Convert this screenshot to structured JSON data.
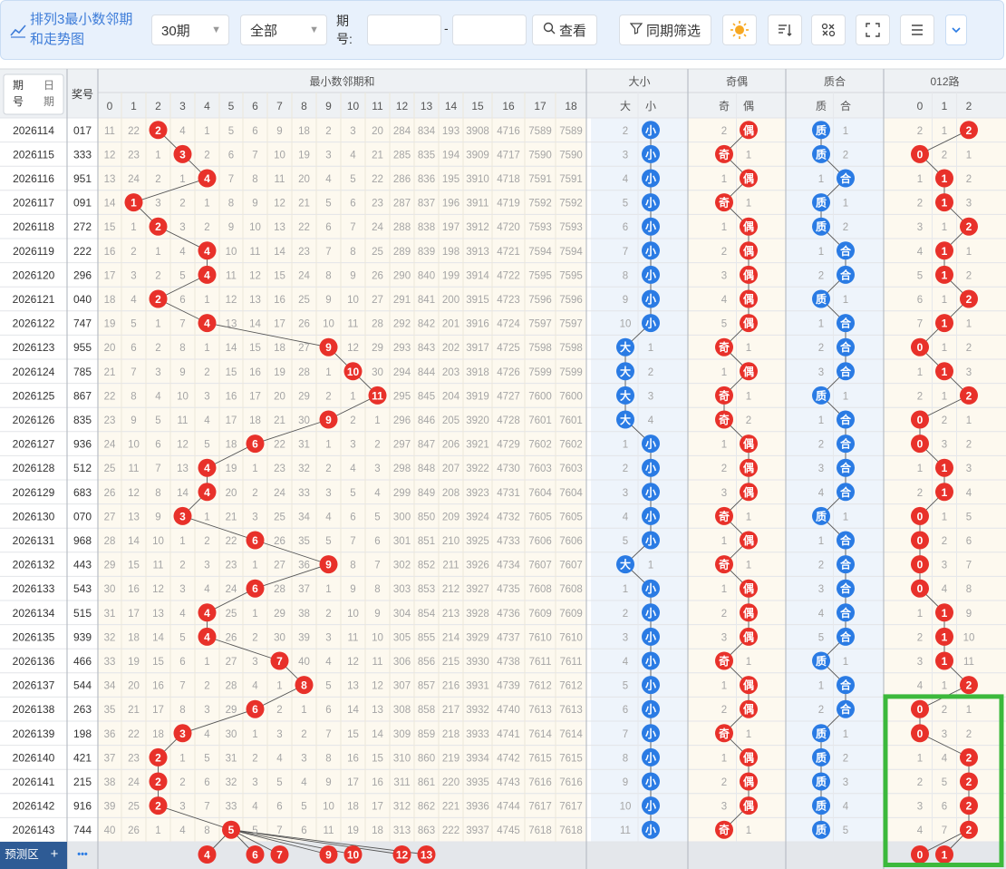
{
  "toolbar": {
    "brand": "排列3最小数邻期和走势图",
    "brand_line1": "排列3最小数邻期",
    "brand_line2": "和走势图",
    "period_select": "30期",
    "scope_select": "全部",
    "period_label_1": "期",
    "period_label_2": "号:",
    "range_sep": "-",
    "period_from": "",
    "period_to": "",
    "query_button": "查看",
    "same_period_button": "同期筛选",
    "icons": [
      "sun-icon",
      "sort-icon",
      "shuffle-icon",
      "fullscreen-icon",
      "menu-icon",
      "chevron-down-icon"
    ]
  },
  "header": {
    "period_col_top": "期",
    "period_col_bottom": "号",
    "date_col_top": "日",
    "date_col_bottom": "期",
    "prize_col": "奖号",
    "group_sum": "最小数邻期和",
    "sum_cols": [
      "0",
      "1",
      "2",
      "3",
      "4",
      "5",
      "6",
      "7",
      "8",
      "9",
      "10",
      "11",
      "12",
      "13",
      "14",
      "15",
      "16",
      "17",
      "18"
    ],
    "group_size": "大小",
    "size_cols": [
      "大",
      "小"
    ],
    "group_parity": "奇偶",
    "parity_cols": [
      "奇",
      "偶"
    ],
    "group_prime": "质合",
    "prime_cols": [
      "质",
      "合"
    ],
    "group_012": "012路",
    "route_cols": [
      "0",
      "1",
      "2"
    ]
  },
  "rows": [
    {
      "period": "2026114",
      "prize": "017",
      "sum": 2,
      "miss": [
        11,
        22,
        0,
        4,
        1,
        5,
        6,
        9,
        18,
        2,
        3,
        20,
        284,
        834,
        193,
        3908,
        4716,
        7589,
        7589
      ],
      "size": "小",
      "sizeMiss": 2,
      "parity": "偶",
      "parMiss": 2,
      "prime": "质",
      "primeMiss": 1,
      "route": 2,
      "routeMiss": [
        2,
        1,
        0
      ]
    },
    {
      "period": "2026115",
      "prize": "333",
      "sum": 3,
      "miss": [
        12,
        23,
        1,
        0,
        2,
        6,
        7,
        10,
        19,
        3,
        4,
        21,
        285,
        835,
        194,
        3909,
        4717,
        7590,
        7590
      ],
      "size": "小",
      "sizeMiss": 3,
      "parity": "奇",
      "parMiss": 1,
      "prime": "质",
      "primeMiss": 2,
      "route": 0,
      "routeMiss": [
        0,
        2,
        1
      ]
    },
    {
      "period": "2026116",
      "prize": "951",
      "sum": 4,
      "miss": [
        13,
        24,
        2,
        1,
        0,
        7,
        8,
        11,
        20,
        4,
        5,
        22,
        286,
        836,
        195,
        3910,
        4718,
        7591,
        7591
      ],
      "size": "小",
      "sizeMiss": 4,
      "parity": "偶",
      "parMiss": 1,
      "prime": "合",
      "primeMiss": 1,
      "route": 1,
      "routeMiss": [
        1,
        0,
        2
      ]
    },
    {
      "period": "2026117",
      "prize": "091",
      "sum": 1,
      "miss": [
        14,
        0,
        3,
        2,
        1,
        8,
        9,
        12,
        21,
        5,
        6,
        23,
        287,
        837,
        196,
        3911,
        4719,
        7592,
        7592
      ],
      "size": "小",
      "sizeMiss": 5,
      "parity": "奇",
      "parMiss": 1,
      "prime": "质",
      "primeMiss": 1,
      "route": 1,
      "routeMiss": [
        2,
        0,
        3
      ]
    },
    {
      "period": "2026118",
      "prize": "272",
      "sum": 2,
      "miss": [
        15,
        1,
        0,
        3,
        2,
        9,
        10,
        13,
        22,
        6,
        7,
        24,
        288,
        838,
        197,
        3912,
        4720,
        7593,
        7593
      ],
      "size": "小",
      "sizeMiss": 6,
      "parity": "偶",
      "parMiss": 1,
      "prime": "质",
      "primeMiss": 2,
      "route": 2,
      "routeMiss": [
        3,
        1,
        0
      ]
    },
    {
      "period": "2026119",
      "prize": "222",
      "sum": 4,
      "miss": [
        16,
        2,
        1,
        4,
        0,
        10,
        11,
        14,
        23,
        7,
        8,
        25,
        289,
        839,
        198,
        3913,
        4721,
        7594,
        7594
      ],
      "size": "小",
      "sizeMiss": 7,
      "parity": "偶",
      "parMiss": 2,
      "prime": "合",
      "primeMiss": 1,
      "route": 1,
      "routeMiss": [
        4,
        0,
        1
      ]
    },
    {
      "period": "2026120",
      "prize": "296",
      "sum": 4,
      "miss": [
        17,
        3,
        2,
        5,
        0,
        11,
        12,
        15,
        24,
        8,
        9,
        26,
        290,
        840,
        199,
        3914,
        4722,
        7595,
        7595
      ],
      "size": "小",
      "sizeMiss": 8,
      "parity": "偶",
      "parMiss": 3,
      "prime": "合",
      "primeMiss": 2,
      "route": 1,
      "routeMiss": [
        5,
        0,
        2
      ]
    },
    {
      "period": "2026121",
      "prize": "040",
      "sum": 2,
      "miss": [
        18,
        4,
        0,
        6,
        1,
        12,
        13,
        16,
        25,
        9,
        10,
        27,
        291,
        841,
        200,
        3915,
        4723,
        7596,
        7596
      ],
      "size": "小",
      "sizeMiss": 9,
      "parity": "偶",
      "parMiss": 4,
      "prime": "质",
      "primeMiss": 1,
      "route": 2,
      "routeMiss": [
        6,
        1,
        0
      ]
    },
    {
      "period": "2026122",
      "prize": "747",
      "sum": 4,
      "miss": [
        19,
        5,
        1,
        7,
        0,
        13,
        14,
        17,
        26,
        10,
        11,
        28,
        292,
        842,
        201,
        3916,
        4724,
        7597,
        7597
      ],
      "size": "小",
      "sizeMiss": 10,
      "parity": "偶",
      "parMiss": 5,
      "prime": "合",
      "primeMiss": 1,
      "route": 1,
      "routeMiss": [
        7,
        0,
        1
      ]
    },
    {
      "period": "2026123",
      "prize": "955",
      "sum": 9,
      "miss": [
        20,
        6,
        2,
        8,
        1,
        14,
        15,
        18,
        27,
        0,
        12,
        29,
        293,
        843,
        202,
        3917,
        4725,
        7598,
        7598
      ],
      "size": "大",
      "sizeMiss": 1,
      "parity": "奇",
      "parMiss": 1,
      "prime": "合",
      "primeMiss": 2,
      "route": 0,
      "routeMiss": [
        0,
        1,
        2
      ]
    },
    {
      "period": "2026124",
      "prize": "785",
      "sum": 10,
      "miss": [
        21,
        7,
        3,
        9,
        2,
        15,
        16,
        19,
        28,
        1,
        0,
        30,
        294,
        844,
        203,
        3918,
        4726,
        7599,
        7599
      ],
      "size": "大",
      "sizeMiss": 2,
      "parity": "偶",
      "parMiss": 1,
      "prime": "合",
      "primeMiss": 3,
      "route": 1,
      "routeMiss": [
        1,
        0,
        3
      ]
    },
    {
      "period": "2026125",
      "prize": "867",
      "sum": 11,
      "miss": [
        22,
        8,
        4,
        10,
        3,
        16,
        17,
        20,
        29,
        2,
        1,
        0,
        295,
        845,
        204,
        3919,
        4727,
        7600,
        7600
      ],
      "size": "大",
      "sizeMiss": 3,
      "parity": "奇",
      "parMiss": 1,
      "prime": "质",
      "primeMiss": 1,
      "route": 2,
      "routeMiss": [
        2,
        1,
        0
      ]
    },
    {
      "period": "2026126",
      "prize": "835",
      "sum": 9,
      "miss": [
        23,
        9,
        5,
        11,
        4,
        17,
        18,
        21,
        30,
        0,
        2,
        1,
        296,
        846,
        205,
        3920,
        4728,
        7601,
        7601
      ],
      "size": "大",
      "sizeMiss": 4,
      "parity": "奇",
      "parMiss": 2,
      "prime": "合",
      "primeMiss": 1,
      "route": 0,
      "routeMiss": [
        0,
        2,
        1
      ]
    },
    {
      "period": "2026127",
      "prize": "936",
      "sum": 6,
      "miss": [
        24,
        10,
        6,
        12,
        5,
        18,
        0,
        22,
        31,
        1,
        3,
        2,
        297,
        847,
        206,
        3921,
        4729,
        7602,
        7602
      ],
      "size": "小",
      "sizeMiss": 1,
      "parity": "偶",
      "parMiss": 1,
      "prime": "合",
      "primeMiss": 2,
      "route": 0,
      "routeMiss": [
        0,
        3,
        2
      ]
    },
    {
      "period": "2026128",
      "prize": "512",
      "sum": 4,
      "miss": [
        25,
        11,
        7,
        13,
        0,
        19,
        1,
        23,
        32,
        2,
        4,
        3,
        298,
        848,
        207,
        3922,
        4730,
        7603,
        7603
      ],
      "size": "小",
      "sizeMiss": 2,
      "parity": "偶",
      "parMiss": 2,
      "prime": "合",
      "primeMiss": 3,
      "route": 1,
      "routeMiss": [
        1,
        0,
        3
      ]
    },
    {
      "period": "2026129",
      "prize": "683",
      "sum": 4,
      "miss": [
        26,
        12,
        8,
        14,
        0,
        20,
        2,
        24,
        33,
        3,
        5,
        4,
        299,
        849,
        208,
        3923,
        4731,
        7604,
        7604
      ],
      "size": "小",
      "sizeMiss": 3,
      "parity": "偶",
      "parMiss": 3,
      "prime": "合",
      "primeMiss": 4,
      "route": 1,
      "routeMiss": [
        2,
        0,
        4
      ]
    },
    {
      "period": "2026130",
      "prize": "070",
      "sum": 3,
      "miss": [
        27,
        13,
        9,
        0,
        1,
        21,
        3,
        25,
        34,
        4,
        6,
        5,
        300,
        850,
        209,
        3924,
        4732,
        7605,
        7605
      ],
      "size": "小",
      "sizeMiss": 4,
      "parity": "奇",
      "parMiss": 1,
      "prime": "质",
      "primeMiss": 1,
      "route": 0,
      "routeMiss": [
        0,
        1,
        5
      ]
    },
    {
      "period": "2026131",
      "prize": "968",
      "sum": 6,
      "miss": [
        28,
        14,
        10,
        1,
        2,
        22,
        0,
        26,
        35,
        5,
        7,
        6,
        301,
        851,
        210,
        3925,
        4733,
        7606,
        7606
      ],
      "size": "小",
      "sizeMiss": 5,
      "parity": "偶",
      "parMiss": 1,
      "prime": "合",
      "primeMiss": 1,
      "route": 0,
      "routeMiss": [
        0,
        2,
        6
      ]
    },
    {
      "period": "2026132",
      "prize": "443",
      "sum": 9,
      "miss": [
        29,
        15,
        11,
        2,
        3,
        23,
        1,
        27,
        36,
        0,
        8,
        7,
        302,
        852,
        211,
        3926,
        4734,
        7607,
        7607
      ],
      "size": "大",
      "sizeMiss": 1,
      "parity": "奇",
      "parMiss": 1,
      "prime": "合",
      "primeMiss": 2,
      "route": 0,
      "routeMiss": [
        0,
        3,
        7
      ]
    },
    {
      "period": "2026133",
      "prize": "543",
      "sum": 6,
      "miss": [
        30,
        16,
        12,
        3,
        4,
        24,
        0,
        28,
        37,
        1,
        9,
        8,
        303,
        853,
        212,
        3927,
        4735,
        7608,
        7608
      ],
      "size": "小",
      "sizeMiss": 1,
      "parity": "偶",
      "parMiss": 1,
      "prime": "合",
      "primeMiss": 3,
      "route": 0,
      "routeMiss": [
        0,
        4,
        8
      ]
    },
    {
      "period": "2026134",
      "prize": "515",
      "sum": 4,
      "miss": [
        31,
        17,
        13,
        4,
        0,
        25,
        1,
        29,
        38,
        2,
        10,
        9,
        304,
        854,
        213,
        3928,
        4736,
        7609,
        7609
      ],
      "size": "小",
      "sizeMiss": 2,
      "parity": "偶",
      "parMiss": 2,
      "prime": "合",
      "primeMiss": 4,
      "route": 1,
      "routeMiss": [
        1,
        0,
        9
      ]
    },
    {
      "period": "2026135",
      "prize": "939",
      "sum": 4,
      "miss": [
        32,
        18,
        14,
        5,
        0,
        26,
        2,
        30,
        39,
        3,
        11,
        10,
        305,
        855,
        214,
        3929,
        4737,
        7610,
        7610
      ],
      "size": "小",
      "sizeMiss": 3,
      "parity": "偶",
      "parMiss": 3,
      "prime": "合",
      "primeMiss": 5,
      "route": 1,
      "routeMiss": [
        2,
        0,
        10
      ]
    },
    {
      "period": "2026136",
      "prize": "466",
      "sum": 7,
      "miss": [
        33,
        19,
        15,
        6,
        1,
        27,
        3,
        0,
        40,
        4,
        12,
        11,
        306,
        856,
        215,
        3930,
        4738,
        7611,
        7611
      ],
      "size": "小",
      "sizeMiss": 4,
      "parity": "奇",
      "parMiss": 1,
      "prime": "质",
      "primeMiss": 1,
      "route": 1,
      "routeMiss": [
        3,
        0,
        11
      ]
    },
    {
      "period": "2026137",
      "prize": "544",
      "sum": 8,
      "miss": [
        34,
        20,
        16,
        7,
        2,
        28,
        4,
        1,
        0,
        5,
        13,
        12,
        307,
        857,
        216,
        3931,
        4739,
        7612,
        7612
      ],
      "size": "小",
      "sizeMiss": 5,
      "parity": "偶",
      "parMiss": 1,
      "prime": "合",
      "primeMiss": 1,
      "route": 2,
      "routeMiss": [
        4,
        1,
        0
      ]
    },
    {
      "period": "2026138",
      "prize": "263",
      "sum": 6,
      "miss": [
        35,
        21,
        17,
        8,
        3,
        29,
        0,
        2,
        1,
        6,
        14,
        13,
        308,
        858,
        217,
        3932,
        4740,
        7613,
        7613
      ],
      "size": "小",
      "sizeMiss": 6,
      "parity": "偶",
      "parMiss": 2,
      "prime": "合",
      "primeMiss": 2,
      "route": 0,
      "routeMiss": [
        0,
        2,
        1
      ]
    },
    {
      "period": "2026139",
      "prize": "198",
      "sum": 3,
      "miss": [
        36,
        22,
        18,
        0,
        4,
        30,
        1,
        3,
        2,
        7,
        15,
        14,
        309,
        859,
        218,
        3933,
        4741,
        7614,
        7614
      ],
      "size": "小",
      "sizeMiss": 7,
      "parity": "奇",
      "parMiss": 1,
      "prime": "质",
      "primeMiss": 1,
      "route": 0,
      "routeMiss": [
        0,
        3,
        2
      ]
    },
    {
      "period": "2026140",
      "prize": "421",
      "sum": 2,
      "miss": [
        37,
        23,
        0,
        1,
        5,
        31,
        2,
        4,
        3,
        8,
        16,
        15,
        310,
        860,
        219,
        3934,
        4742,
        7615,
        7615
      ],
      "size": "小",
      "sizeMiss": 8,
      "parity": "偶",
      "parMiss": 1,
      "prime": "质",
      "primeMiss": 2,
      "route": 2,
      "routeMiss": [
        1,
        4,
        0
      ]
    },
    {
      "period": "2026141",
      "prize": "215",
      "sum": 2,
      "miss": [
        38,
        24,
        0,
        2,
        6,
        32,
        3,
        5,
        4,
        9,
        17,
        16,
        311,
        861,
        220,
        3935,
        4743,
        7616,
        7616
      ],
      "size": "小",
      "sizeMiss": 9,
      "parity": "偶",
      "parMiss": 2,
      "prime": "质",
      "primeMiss": 3,
      "route": 2,
      "routeMiss": [
        2,
        5,
        0
      ]
    },
    {
      "period": "2026142",
      "prize": "916",
      "sum": 2,
      "miss": [
        39,
        25,
        0,
        3,
        7,
        33,
        4,
        6,
        5,
        10,
        18,
        17,
        312,
        862,
        221,
        3936,
        4744,
        7617,
        7617
      ],
      "size": "小",
      "sizeMiss": 10,
      "parity": "偶",
      "parMiss": 3,
      "prime": "质",
      "primeMiss": 4,
      "route": 2,
      "routeMiss": [
        3,
        6,
        0
      ]
    },
    {
      "period": "2026143",
      "prize": "744",
      "sum": 5,
      "miss": [
        40,
        26,
        1,
        4,
        8,
        0,
        5,
        7,
        6,
        11,
        19,
        18,
        313,
        863,
        222,
        3937,
        4745,
        7618,
        7618
      ],
      "size": "小",
      "sizeMiss": 11,
      "parity": "奇",
      "parMiss": 1,
      "prime": "质",
      "primeMiss": 5,
      "route": 2,
      "routeMiss": [
        4,
        7,
        0
      ]
    }
  ],
  "footer": {
    "predict_button": "预测区",
    "plus_icon": "+",
    "more_icon": "•••",
    "predict_sum": [
      4,
      6,
      7,
      9,
      10,
      12,
      13
    ],
    "predict_route": [
      0,
      1
    ]
  },
  "colors": {
    "red_ball": "#e8312a",
    "blue_ball": "#2a7be4",
    "highlight_box": "#3cb93c",
    "header_bg": "#eef1f4",
    "cell_bg": "#fdf9ef",
    "size_bg": "#eef4fb",
    "predict_btn": "#2e5b95"
  }
}
